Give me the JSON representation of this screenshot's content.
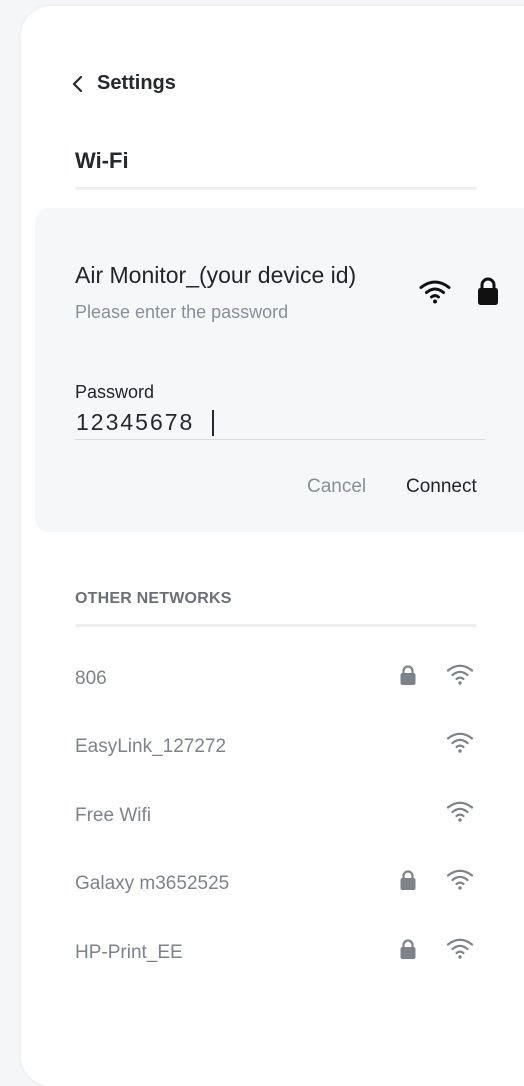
{
  "header": {
    "back_label": "Settings",
    "title": "Wi-Fi"
  },
  "selected_network": {
    "name": "Air Monitor_(your device id)",
    "subtitle": "Please enter the password",
    "password_label": "Password",
    "password_value": "12345678",
    "cancel_label": "Cancel",
    "connect_label": "Connect",
    "icons": [
      "wifi-icon",
      "lock-icon"
    ]
  },
  "other_networks": {
    "heading": "OTHER NETWORKS",
    "items": [
      {
        "name": "806",
        "locked": true
      },
      {
        "name": "EasyLink_127272",
        "locked": false
      },
      {
        "name": "Free Wifi",
        "locked": false
      },
      {
        "name": "Galaxy m3652525",
        "locked": true
      },
      {
        "name": "HP-Print_EE",
        "locked": true
      }
    ]
  },
  "colors": {
    "primary_text": "#222529",
    "muted_text": "#8a8f95",
    "icon_muted": "#7e838a",
    "card_background": "#f6f7f9"
  }
}
